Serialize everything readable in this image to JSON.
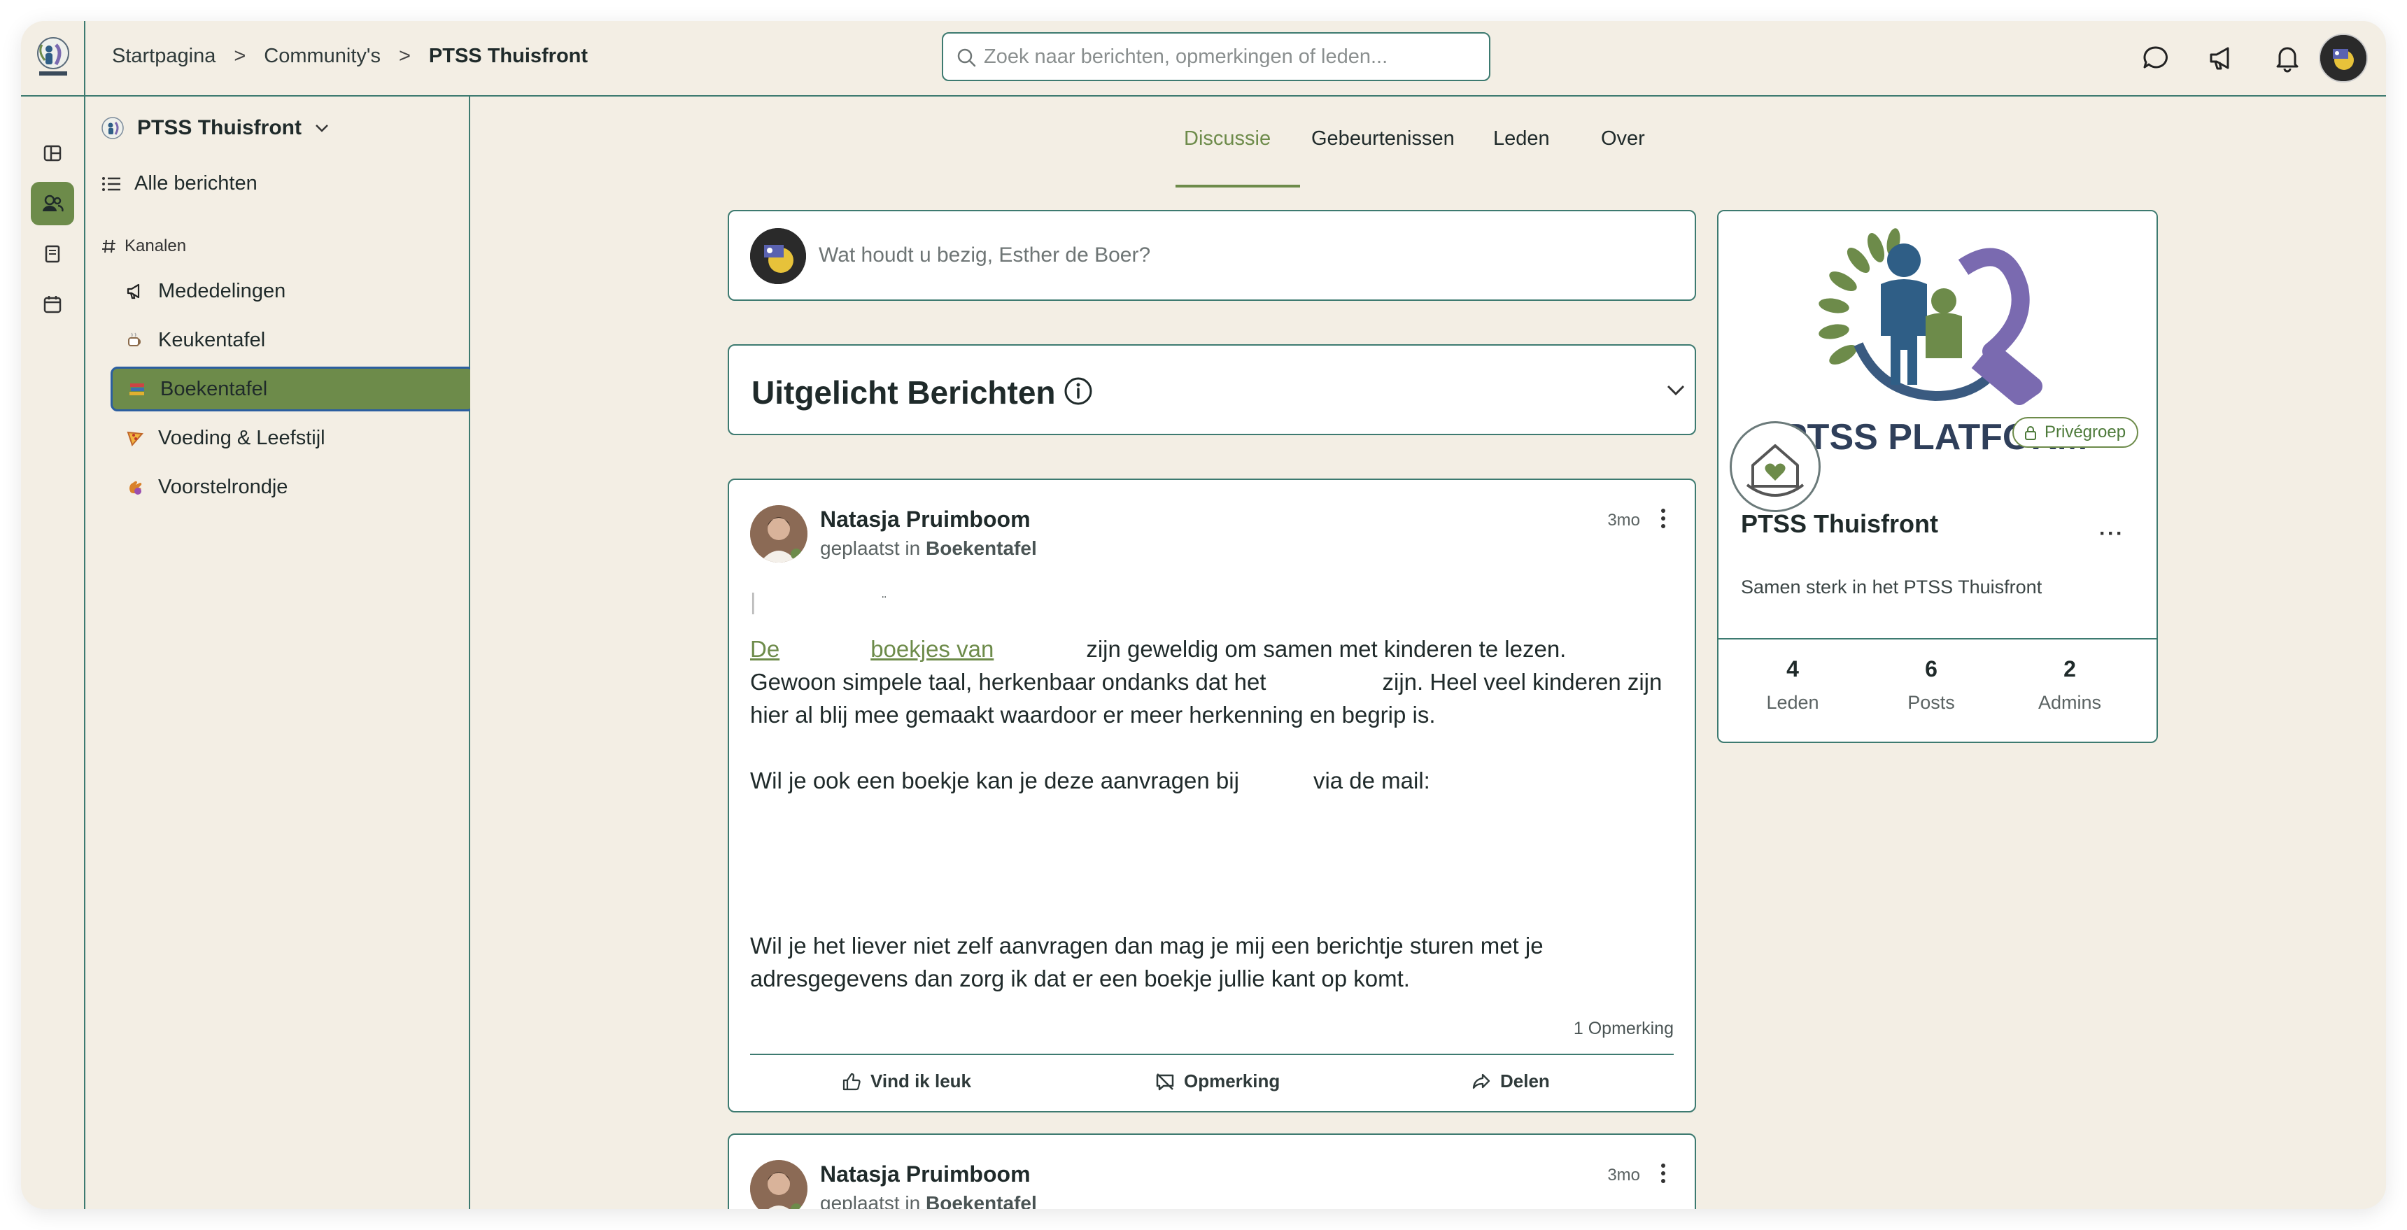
{
  "breadcrumb": {
    "home": "Startpagina",
    "communities": "Community's",
    "current": "PTSS Thuisfront",
    "separator": ">"
  },
  "search": {
    "placeholder": "Zoek naar berichten, opmerkingen of leden..."
  },
  "sidebar": {
    "group_name": "PTSS Thuisfront",
    "all_posts": "Alle berichten",
    "channels_heading": "Kanalen",
    "channels": [
      {
        "label": "Mededelingen",
        "icon": "megaphone-icon"
      },
      {
        "label": "Keukentafel",
        "icon": "coffee-icon"
      },
      {
        "label": "Boekentafel",
        "icon": "books-icon",
        "active": true
      },
      {
        "label": "Voeding & Leefstijl",
        "icon": "pizza-icon"
      },
      {
        "label": "Voorstelrondje",
        "icon": "wave-icon"
      }
    ]
  },
  "tabs": [
    {
      "label": "Discussie",
      "active": true
    },
    {
      "label": "Gebeurtenissen"
    },
    {
      "label": "Leden"
    },
    {
      "label": "Over"
    }
  ],
  "compose": {
    "placeholder": "Wat houdt u bezig, Esther de Boer?"
  },
  "featured": {
    "title": "Uitgelicht Berichten"
  },
  "posts": [
    {
      "author": "Natasja Pruimboom",
      "posted_in_label": "geplaatst in",
      "channel": "Boekentafel",
      "time": "3mo",
      "link_part1": "De",
      "link_part2": "boekjes van",
      "line1_rest": "zijn geweldig om samen met kinderen te lezen.",
      "line2a": "Gewoon simpele taal, herkenbaar ondanks dat het",
      "line2b": "zijn. Heel veel kinderen zijn",
      "line3": "hier al blij mee gemaakt waardoor er meer herkenning en begrip is.",
      "line4a": "Wil je ook een boekje kan je deze aanvragen bij",
      "line4b": "via de mail:",
      "line5": "Wil je het liever niet zelf aanvragen dan mag je mij een berichtje sturen met je",
      "line6": "adresgegevens dan zorg ik dat er een boekje jullie kant op komt.",
      "comment_count": "1 Opmerking",
      "actions": {
        "like": "Vind ik leuk",
        "comment": "Opmerking",
        "share": "Delen"
      }
    },
    {
      "author": "Natasja Pruimboom",
      "posted_in_label": "geplaatst in",
      "channel": "Boekentafel",
      "time": "3mo"
    }
  ],
  "group_card": {
    "banner_text": "PTSS PLATFORM",
    "privacy_badge": "Privégroep",
    "name": "PTSS Thuisfront",
    "description": "Samen sterk in het PTSS Thuisfront",
    "stats": [
      {
        "value": "4",
        "label": "Leden"
      },
      {
        "value": "6",
        "label": "Posts"
      },
      {
        "value": "2",
        "label": "Admins"
      }
    ]
  },
  "colors": {
    "accent_green": "#6d8b4a",
    "border_teal": "#3d7a70",
    "background": "#f3eee4",
    "active_outline": "#2b5ea0"
  }
}
